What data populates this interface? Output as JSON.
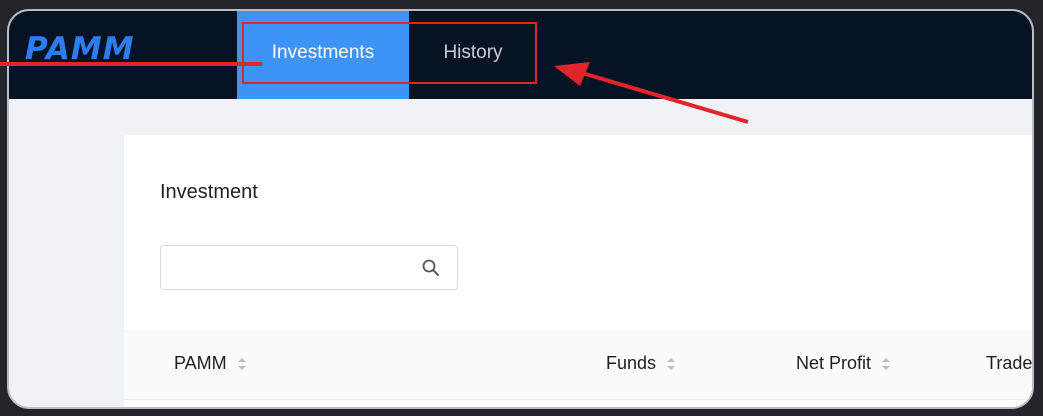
{
  "app": {
    "logo_text": "PAMM"
  },
  "nav": {
    "tabs": [
      {
        "label": "Investments",
        "active": true
      },
      {
        "label": "History",
        "active": false
      }
    ]
  },
  "main": {
    "title": "Investment",
    "search": {
      "value": "",
      "placeholder": "",
      "icon": "search-icon"
    },
    "table": {
      "columns": [
        "PAMM",
        "Funds",
        "Net Profit",
        "Trade"
      ]
    }
  },
  "colors": {
    "nav_bg": "#061325",
    "active_tab": "#3d93f6",
    "logo": "#2f7cf0",
    "annotation": "#e0252b"
  }
}
